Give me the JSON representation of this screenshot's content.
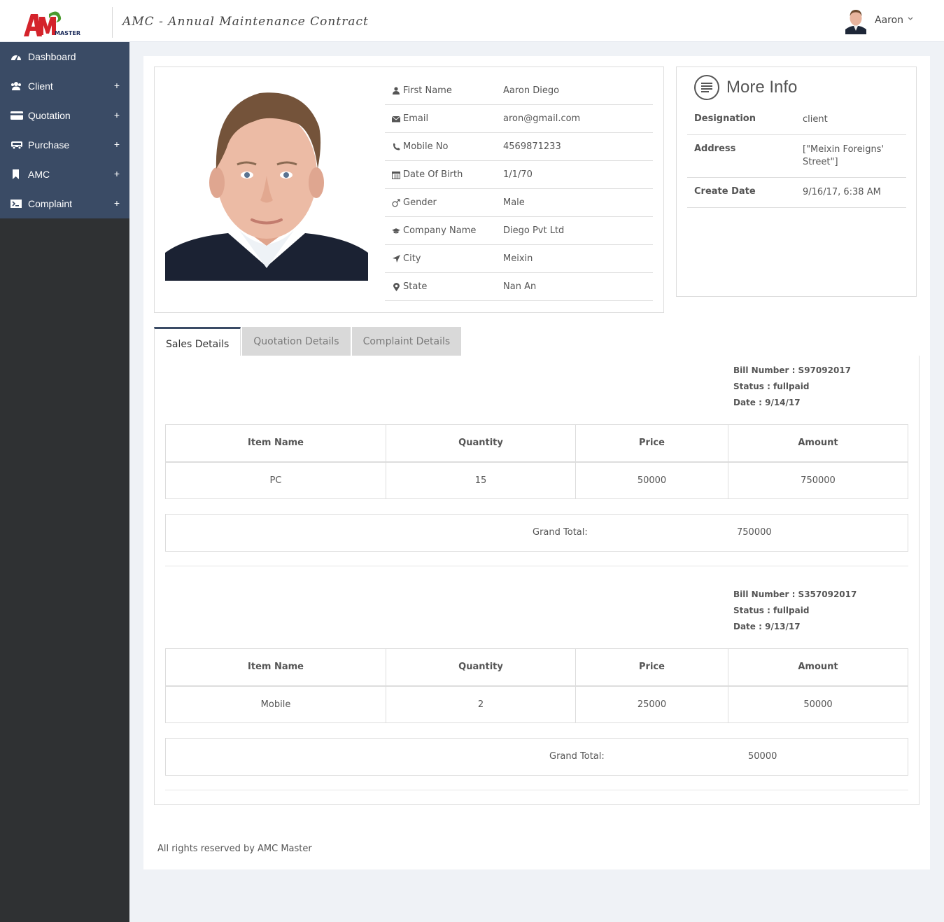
{
  "header": {
    "logo_text": "MASTER",
    "app_title": "AMC - Annual Maintenance Contract",
    "user_name": "Aaron"
  },
  "sidebar": {
    "items": [
      {
        "label": "Dashboard",
        "icon": "dashboard-icon",
        "expandable": false
      },
      {
        "label": "Client",
        "icon": "users-icon",
        "expandable": true
      },
      {
        "label": "Quotation",
        "icon": "credit-card-icon",
        "expandable": true
      },
      {
        "label": "Purchase",
        "icon": "truck-icon",
        "expandable": true
      },
      {
        "label": "AMC",
        "icon": "bookmark-icon",
        "expandable": true
      },
      {
        "label": "Complaint",
        "icon": "terminal-icon",
        "expandable": true
      }
    ],
    "plus": "+"
  },
  "profile": {
    "fields": [
      {
        "icon": "user-icon",
        "label": "First Name",
        "value": "Aaron Diego"
      },
      {
        "icon": "envelope-icon",
        "label": "Email",
        "value": "aron@gmail.com"
      },
      {
        "icon": "phone-icon",
        "label": "Mobile No",
        "value": "4569871233"
      },
      {
        "icon": "calendar-icon",
        "label": "Date Of Birth",
        "value": "1/1/70"
      },
      {
        "icon": "mars-icon",
        "label": "Gender",
        "value": "Male"
      },
      {
        "icon": "graduation-cap-icon",
        "label": "Company Name",
        "value": "Diego Pvt Ltd"
      },
      {
        "icon": "location-arrow-icon",
        "label": "City",
        "value": "Meixin"
      },
      {
        "icon": "map-marker-icon",
        "label": "State",
        "value": "Nan An"
      }
    ]
  },
  "more_info": {
    "title": "More Info",
    "rows": [
      {
        "label": "Designation",
        "value": "client"
      },
      {
        "label": "Address",
        "value": "[\"Meixin Foreigns' Street\"]"
      },
      {
        "label": "Create Date",
        "value": "9/16/17, 6:38 AM"
      }
    ]
  },
  "tabs": [
    {
      "label": "Sales Details",
      "active": true
    },
    {
      "label": "Quotation Details",
      "active": false
    },
    {
      "label": "Complaint Details",
      "active": false
    }
  ],
  "sales": {
    "columns": [
      "Item Name",
      "Quantity",
      "Price",
      "Amount"
    ],
    "grand_total_label": "Grand Total:",
    "bills": [
      {
        "bill_number": "Bill Number : S97092017",
        "status": "Status : fullpaid",
        "date": "Date : 9/14/17",
        "rows": [
          [
            "PC",
            "15",
            "50000",
            "750000"
          ]
        ],
        "grand_total": "750000"
      },
      {
        "bill_number": "Bill Number : S357092017",
        "status": "Status : fullpaid",
        "date": "Date : 9/13/17",
        "rows": [
          [
            "Mobile",
            "2",
            "25000",
            "50000"
          ]
        ],
        "grand_total": "50000"
      }
    ]
  },
  "footer": {
    "text": "All rights reserved by AMC Master"
  },
  "colors": {
    "sidebar_menu": "#3a4b65",
    "sidebar_bg": "#2f3133",
    "page_bg": "#eff2f6",
    "logo_red": "#d4232b",
    "logo_green": "#4a9a2e"
  }
}
